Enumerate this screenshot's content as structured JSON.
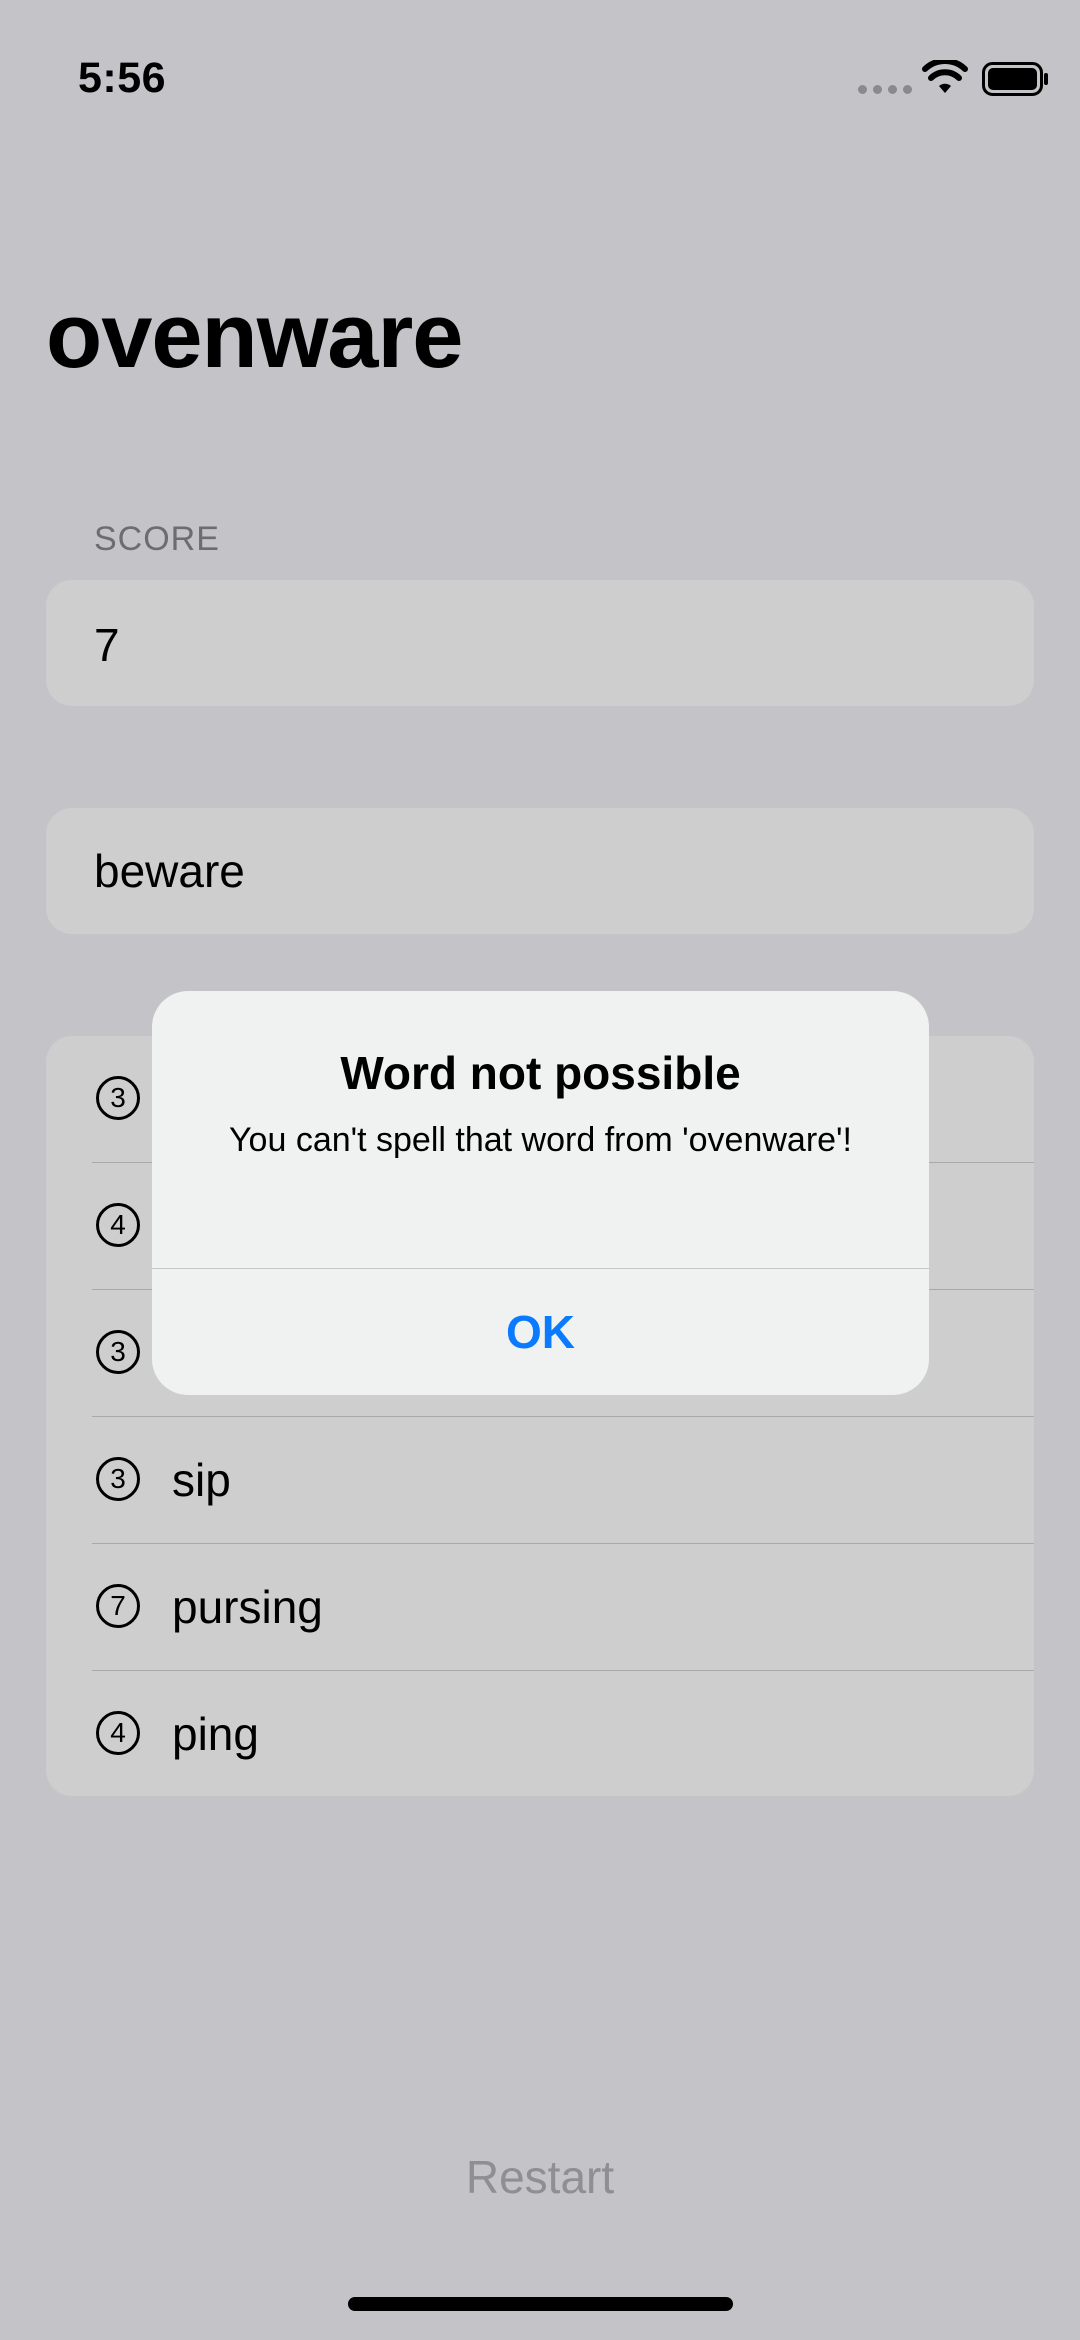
{
  "status_bar": {
    "time": "5:56"
  },
  "nav": {
    "title": "ovenware"
  },
  "score": {
    "header": "SCORE",
    "value": "7"
  },
  "input": {
    "value": "beware"
  },
  "words": [
    {
      "count": "3",
      "word": ""
    },
    {
      "count": "4",
      "word": ""
    },
    {
      "count": "3",
      "word": ""
    },
    {
      "count": "3",
      "word": "sip"
    },
    {
      "count": "7",
      "word": "pursing"
    },
    {
      "count": "4",
      "word": "ping"
    }
  ],
  "restart_label": "Restart",
  "alert": {
    "title": "Word not possible",
    "message": "You can't spell that word from 'ovenware'!",
    "ok_label": "OK"
  },
  "colors": {
    "accent": "#0a7aff",
    "background": "#c4c3c8",
    "card": "#cececf"
  },
  "icons": {
    "wifi": "wifi-icon",
    "battery": "battery-icon",
    "signal": "cellular-signal-icon"
  }
}
